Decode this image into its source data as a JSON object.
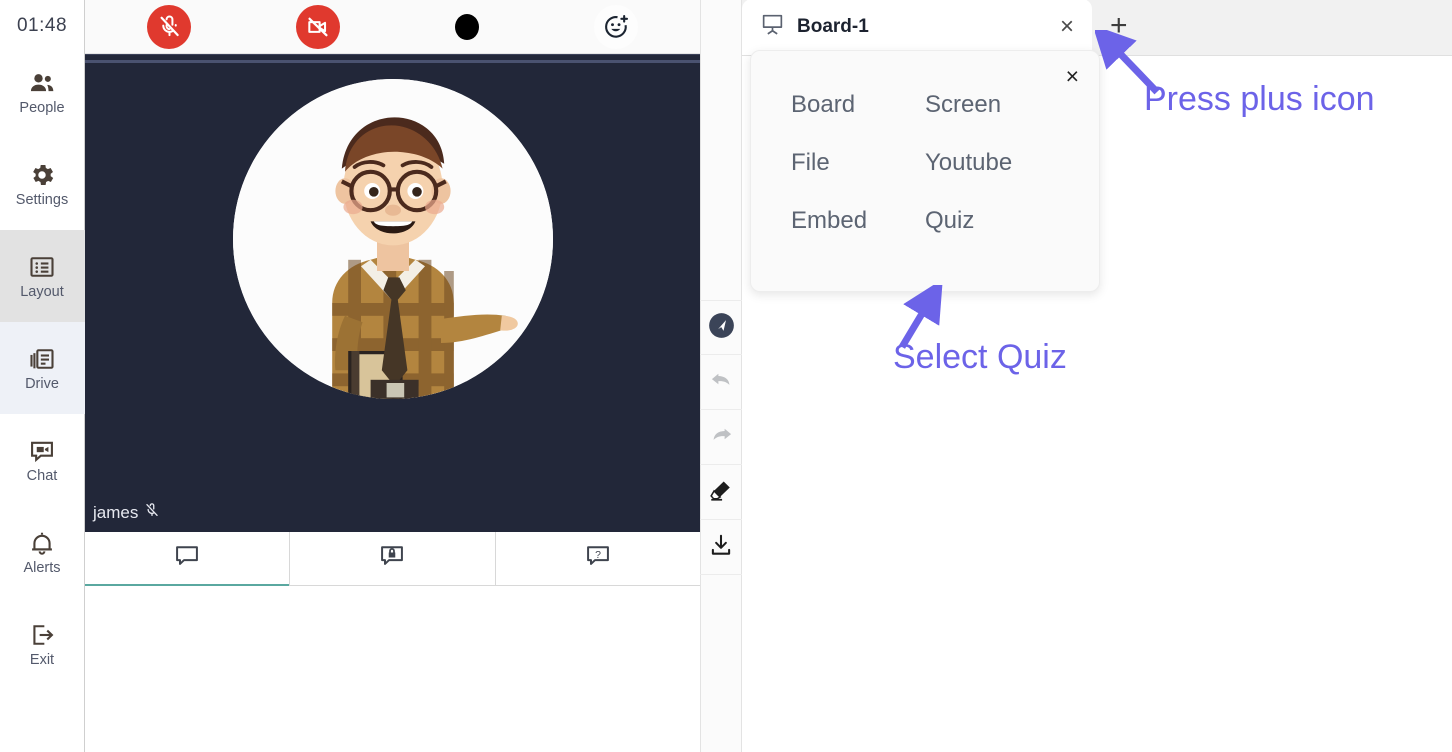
{
  "sidebar": {
    "timer": "01:48",
    "items": [
      {
        "label": "People",
        "icon": "people-icon"
      },
      {
        "label": "Settings",
        "icon": "gear-icon"
      },
      {
        "label": "Layout",
        "icon": "layout-icon"
      },
      {
        "label": "Drive",
        "icon": "drive-icon"
      },
      {
        "label": "Chat",
        "icon": "chat-video-icon"
      },
      {
        "label": "Alerts",
        "icon": "bell-icon"
      },
      {
        "label": "Exit",
        "icon": "exit-icon"
      }
    ]
  },
  "meeting_toolbar": {
    "mic_label": "mic-muted",
    "camera_label": "camera-off",
    "record_label": "record",
    "reaction_label": "add-reaction"
  },
  "video": {
    "participant_name": "james",
    "muted": true,
    "background_color": "#222739"
  },
  "chat_tabs": [
    {
      "label": "Public chat",
      "icon": "chat-bubble-icon",
      "active": true
    },
    {
      "label": "Private chat",
      "icon": "chat-bubble-lock-icon",
      "active": false
    },
    {
      "label": "Q and A",
      "icon": "chat-bubble-question-icon",
      "active": false
    }
  ],
  "tool_rail": [
    {
      "label": "Pointer",
      "icon": "cursor-icon"
    },
    {
      "label": "Undo",
      "icon": "undo-icon"
    },
    {
      "label": "Redo",
      "icon": "redo-icon"
    },
    {
      "label": "Eraser",
      "icon": "eraser-icon"
    },
    {
      "label": "Download",
      "icon": "download-icon"
    }
  ],
  "board": {
    "tab_title": "Board-1",
    "tab_icon": "whiteboard-icon",
    "close_label": "×",
    "add_label": "+"
  },
  "popup": {
    "close_label": "×",
    "items": [
      "Board",
      "Screen",
      "File",
      "Youtube",
      "Embed",
      "Quiz"
    ]
  },
  "annotations": {
    "press_plus": "Press plus icon",
    "select_quiz": "Select Quiz",
    "color": "#6c63e8"
  }
}
